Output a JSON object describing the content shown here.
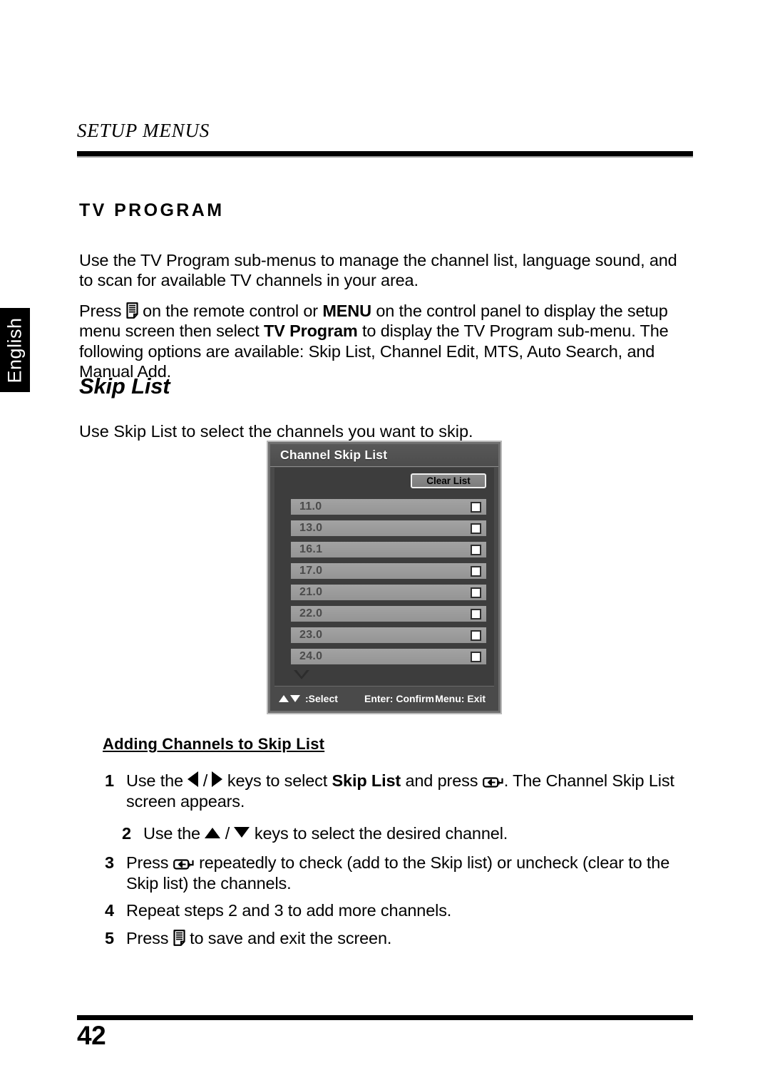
{
  "language_tab": {
    "label": "English"
  },
  "running_head": "SETUP MENUS",
  "section": {
    "title": "TV PROGRAM",
    "paragraph1": "Use the TV Program sub-menus to manage the channel list, language sound, and to scan for available TV channels in your area.",
    "paragraph2_parts": {
      "a": "Press ",
      "icon1": "menu-remote-icon",
      "b": " on the remote control or ",
      "bold1": "MENU",
      "c": " on the control panel to display the setup menu screen then select ",
      "bold2": "TV Program",
      "d": " to display the TV Program sub-menu. The following options are available: Skip List, Channel Edit, MTS, Auto Search, and Manual Add."
    }
  },
  "subsection": {
    "title": "Skip List",
    "intro": "Use Skip List to select the channels you want to skip."
  },
  "osd": {
    "title": "Channel Skip List",
    "clear_button": "Clear List",
    "channels": [
      {
        "label": "11.0",
        "checked": false
      },
      {
        "label": "13.0",
        "checked": false
      },
      {
        "label": "16.1",
        "checked": false
      },
      {
        "label": "17.0",
        "checked": false
      },
      {
        "label": "21.0",
        "checked": false
      },
      {
        "label": "22.0",
        "checked": false
      },
      {
        "label": "23.0",
        "checked": false
      },
      {
        "label": "24.0",
        "checked": false
      }
    ],
    "scroll_indicator": "scroll-down-arrow",
    "footer": {
      "select": ":Select",
      "enter": "Enter: Confirm",
      "exit": "Menu: Exit"
    },
    "colors": {
      "bezel": "#6f6f6f",
      "panel": "#4a4a4a",
      "list_bg": "#3d3d3d",
      "row": "#9b9b9b",
      "row_text": "#4b4b4b",
      "title_text": "#ffffff"
    }
  },
  "procedure": {
    "heading": "Adding Channels to Skip List",
    "steps": [
      {
        "num": "1",
        "a": "Use the ",
        "icon_left": "arrow-left-icon",
        "sep": " / ",
        "icon_right": "arrow-right-icon",
        "b": " keys to select ",
        "bold": "Skip List",
        "c": " and press ",
        "icon_enter": "enter-key-icon",
        "d": ". The Channel Skip List screen appears."
      },
      {
        "num": "2",
        "a": "Use the ",
        "icon_up": "arrow-up-icon",
        "sep": " / ",
        "icon_down": "arrow-down-icon",
        "b": " keys to select the desired channel."
      },
      {
        "num": "3",
        "a": "Press ",
        "icon_enter": "enter-key-icon",
        "b": " repeatedly to check (add to the Skip list) or uncheck (clear to the Skip list) the channels."
      },
      {
        "num": "4",
        "a": "Repeat steps 2 and 3 to add more channels."
      },
      {
        "num": "5",
        "a": "Press ",
        "icon_menu": "menu-remote-icon",
        "b": " to save and exit the screen."
      }
    ]
  },
  "page_number": "42"
}
